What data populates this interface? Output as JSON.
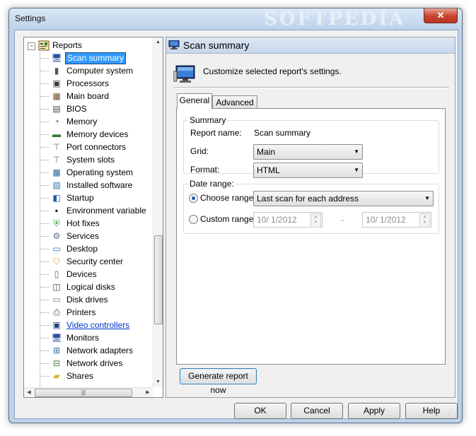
{
  "window": {
    "title": "Settings",
    "watermark": "SOFTPEDIA",
    "close_label": "✕"
  },
  "tree": {
    "root": {
      "label": "Reports",
      "expander": "−",
      "icon": "reports-icon"
    },
    "items": [
      {
        "label": "Scan summary",
        "icon": "monitor-icon",
        "selected": true
      },
      {
        "label": "Computer system",
        "icon": "tower-icon"
      },
      {
        "label": "Processors",
        "icon": "chip-icon"
      },
      {
        "label": "Main board",
        "icon": "motherboard-icon"
      },
      {
        "label": "BIOS",
        "icon": "bios-chip-icon"
      },
      {
        "label": "Memory",
        "icon": "memory-pie-icon"
      },
      {
        "label": "Memory devices",
        "icon": "ram-stick-icon"
      },
      {
        "label": "Port connectors",
        "icon": "port-icon"
      },
      {
        "label": "System slots",
        "icon": "slot-icon"
      },
      {
        "label": "Operating system",
        "icon": "os-icon"
      },
      {
        "label": "Installed software",
        "icon": "software-icon"
      },
      {
        "label": "Startup",
        "icon": "startup-icon"
      },
      {
        "label": "Environment variable",
        "icon": "console-icon"
      },
      {
        "label": "Hot fixes",
        "icon": "shield-icon"
      },
      {
        "label": "Services",
        "icon": "gear-icon"
      },
      {
        "label": "Desktop",
        "icon": "desktop-icon"
      },
      {
        "label": "Security center",
        "icon": "security-shield-icon"
      },
      {
        "label": "Devices",
        "icon": "devices-icon"
      },
      {
        "label": "Logical disks",
        "icon": "logical-disk-icon"
      },
      {
        "label": "Disk drives",
        "icon": "disk-drive-icon"
      },
      {
        "label": "Printers",
        "icon": "printer-icon"
      },
      {
        "label": "Video controllers",
        "icon": "video-controller-icon",
        "link": true
      },
      {
        "label": "Monitors",
        "icon": "monitor-icon"
      },
      {
        "label": "Network adapters",
        "icon": "network-adapter-icon"
      },
      {
        "label": "Network drives",
        "icon": "network-drive-icon"
      },
      {
        "label": "Shares",
        "icon": "shared-folder-icon"
      }
    ],
    "hscroll_grip": "|||"
  },
  "panel": {
    "title": "Scan summary",
    "description": "Customize selected report's settings.",
    "tabs": [
      {
        "label": "General",
        "active": true
      },
      {
        "label": "Advanced",
        "active": false
      }
    ],
    "summary": {
      "legend": "Summary",
      "report_name_label": "Report name:",
      "report_name_value": "Scan summary",
      "grid_label": "Grid:",
      "grid_value": "Main",
      "format_label": "Format:",
      "format_value": "HTML"
    },
    "date_range": {
      "legend": "Date range:",
      "choose_label": "Choose range:",
      "choose_value": "Last scan for each address",
      "custom_label": "Custom range:",
      "from": "10/  1/2012",
      "separator": "-",
      "to": "10/  1/2012",
      "selected": "choose"
    },
    "generate_label": "Generate report now"
  },
  "buttons": {
    "ok": "OK",
    "cancel": "Cancel",
    "apply": "Apply",
    "help": "Help"
  }
}
